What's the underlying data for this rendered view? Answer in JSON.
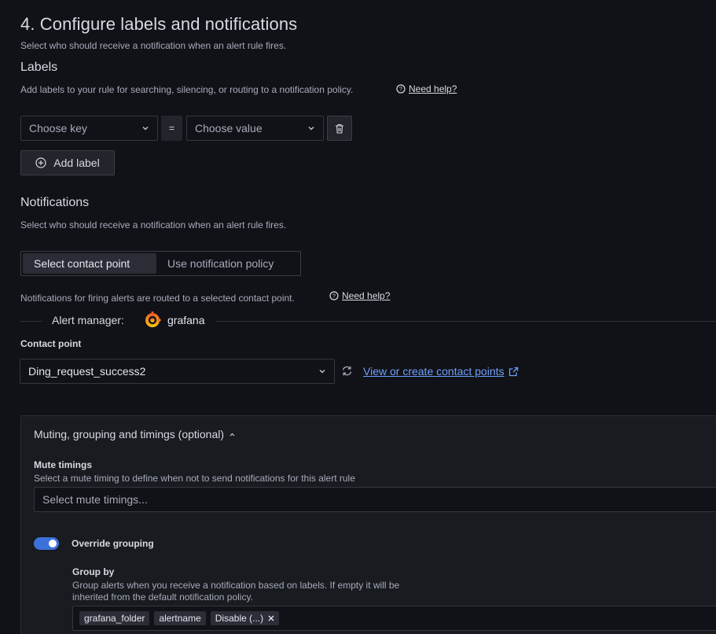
{
  "section": {
    "title": "4. Configure labels and notifications",
    "subtitle": "Select who should receive a notification when an alert rule fires."
  },
  "labels": {
    "heading": "Labels",
    "description": "Add labels to your rule for searching, silencing, or routing to a notification policy.",
    "help_link": "Need help?",
    "key_placeholder": "Choose key",
    "operator": "=",
    "value_placeholder": "Choose value",
    "add_label_button": "Add label"
  },
  "notifications": {
    "heading": "Notifications",
    "description": "Select who should receive a notification when an alert rule fires.",
    "options": [
      "Select contact point",
      "Use notification policy"
    ],
    "selected_option": "Select contact point",
    "routing_note": "Notifications for firing alerts are routed to a selected contact point.",
    "help_link": "Need help?",
    "alert_manager_label": "Alert manager:",
    "alert_manager_value": "grafana",
    "contact_point_label": "Contact point",
    "contact_point_value": "Ding_request_success2",
    "view_create_link": "View or create contact points"
  },
  "muting": {
    "title": "Muting, grouping and timings (optional)",
    "expanded": true,
    "mute_timings_label": "Mute timings",
    "mute_timings_description": "Select a mute timing to define when not to send notifications for this alert rule",
    "mute_timings_placeholder": "Select mute timings...",
    "override_grouping_label": "Override grouping",
    "override_grouping_on": true,
    "group_by_label": "Group by",
    "group_by_description_line1": "Group alerts when you receive a notification based on labels. If empty it will be",
    "group_by_description_line2": "inherited from the default notification policy.",
    "group_by_tags": [
      "grafana_folder",
      "alertname",
      "Disable (...)"
    ]
  },
  "colors": {
    "background": "#111217",
    "accent": "#6e9fff",
    "toggle": "#3d71d9",
    "panel": "#181b1f"
  }
}
